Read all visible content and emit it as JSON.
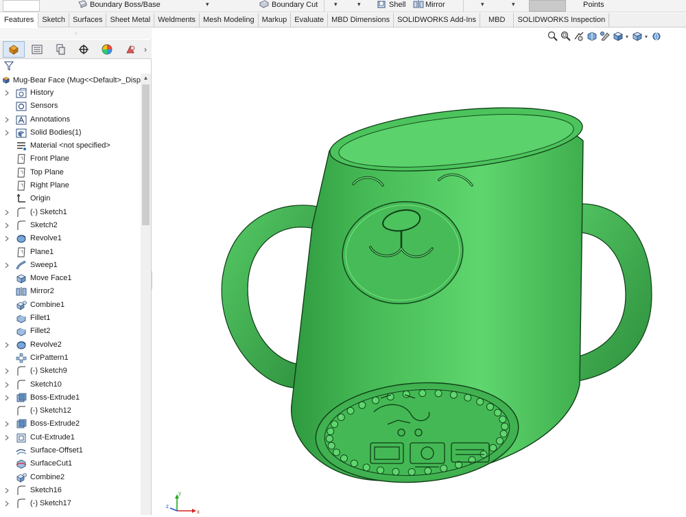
{
  "ribbon_top": {
    "boundary_boss_label": "Boundary Boss/Base",
    "boundary_cut_label": "Boundary Cut",
    "shell_label": "Shell",
    "mirror_label": "Mirror",
    "points_label": "Points"
  },
  "command_tabs": [
    {
      "label": "Features"
    },
    {
      "label": "Sketch"
    },
    {
      "label": "Surfaces"
    },
    {
      "label": "Sheet Metal"
    },
    {
      "label": "Weldments"
    },
    {
      "label": "Mesh Modeling"
    },
    {
      "label": "Markup"
    },
    {
      "label": "Evaluate"
    },
    {
      "label": "MBD Dimensions"
    },
    {
      "label": "SOLIDWORKS Add-Ins"
    },
    {
      "label": "MBD"
    },
    {
      "label": "SOLIDWORKS Inspection"
    }
  ],
  "feature_tree": {
    "root_label": "Mug-Bear Face  (Mug<<Default>_Disp",
    "items": [
      {
        "label": "History",
        "icon": "history-folder-icon",
        "expandable": true
      },
      {
        "label": "Sensors",
        "icon": "sensors-icon",
        "expandable": false
      },
      {
        "label": "Annotations",
        "icon": "annotations-icon",
        "expandable": true
      },
      {
        "label": "Solid Bodies(1)",
        "icon": "solid-bodies-icon",
        "expandable": true
      },
      {
        "label": "Material <not specified>",
        "icon": "material-icon",
        "expandable": false
      },
      {
        "label": "Front Plane",
        "icon": "plane-icon",
        "expandable": false
      },
      {
        "label": "Top Plane",
        "icon": "plane-icon",
        "expandable": false
      },
      {
        "label": "Right Plane",
        "icon": "plane-icon",
        "expandable": false
      },
      {
        "label": "Origin",
        "icon": "origin-icon",
        "expandable": false
      },
      {
        "label": "(-) Sketch1",
        "icon": "sketch-icon",
        "expandable": true
      },
      {
        "label": "Sketch2",
        "icon": "sketch-icon",
        "expandable": true
      },
      {
        "label": "Revolve1",
        "icon": "revolve-icon",
        "expandable": true
      },
      {
        "label": "Plane1",
        "icon": "plane-icon",
        "expandable": false
      },
      {
        "label": "Sweep1",
        "icon": "sweep-icon",
        "expandable": true
      },
      {
        "label": "Move Face1",
        "icon": "move-face-icon",
        "expandable": false
      },
      {
        "label": "Mirror2",
        "icon": "mirror-icon",
        "expandable": false
      },
      {
        "label": "Combine1",
        "icon": "combine-icon",
        "expandable": false
      },
      {
        "label": "Fillet1",
        "icon": "fillet-icon",
        "expandable": false
      },
      {
        "label": "Fillet2",
        "icon": "fillet-icon",
        "expandable": false
      },
      {
        "label": "Revolve2",
        "icon": "revolve-icon",
        "expandable": true
      },
      {
        "label": "CirPattern1",
        "icon": "circular-pattern-icon",
        "expandable": false
      },
      {
        "label": "(-) Sketch9",
        "icon": "sketch-icon",
        "expandable": true
      },
      {
        "label": "Sketch10",
        "icon": "sketch-icon",
        "expandable": true
      },
      {
        "label": "Boss-Extrude1",
        "icon": "boss-extrude-icon",
        "expandable": true
      },
      {
        "label": "(-) Sketch12",
        "icon": "sketch-icon",
        "expandable": false
      },
      {
        "label": "Boss-Extrude2",
        "icon": "boss-extrude-icon",
        "expandable": true
      },
      {
        "label": "Cut-Extrude1",
        "icon": "cut-extrude-icon",
        "expandable": true
      },
      {
        "label": "Surface-Offset1",
        "icon": "surface-offset-icon",
        "expandable": false
      },
      {
        "label": "SurfaceCut1",
        "icon": "surface-cut-icon",
        "expandable": false
      },
      {
        "label": "Combine2",
        "icon": "combine-icon",
        "expandable": false
      },
      {
        "label": "Sketch16",
        "icon": "sketch-icon",
        "expandable": true
      },
      {
        "label": "(-) Sketch17",
        "icon": "sketch-icon",
        "expandable": true
      }
    ]
  },
  "model": {
    "name": "bear-face-mug",
    "color": "#4cc35c",
    "highlight_color": "#6fe07c",
    "shadow_color": "#1f7a2c"
  },
  "triad": {
    "x_label": "x",
    "y_label": "y",
    "z_label": "z"
  },
  "colors": {
    "accent": "#2b6cc4",
    "panel_bg": "#ffffff",
    "tab_active": "#ffffff"
  }
}
